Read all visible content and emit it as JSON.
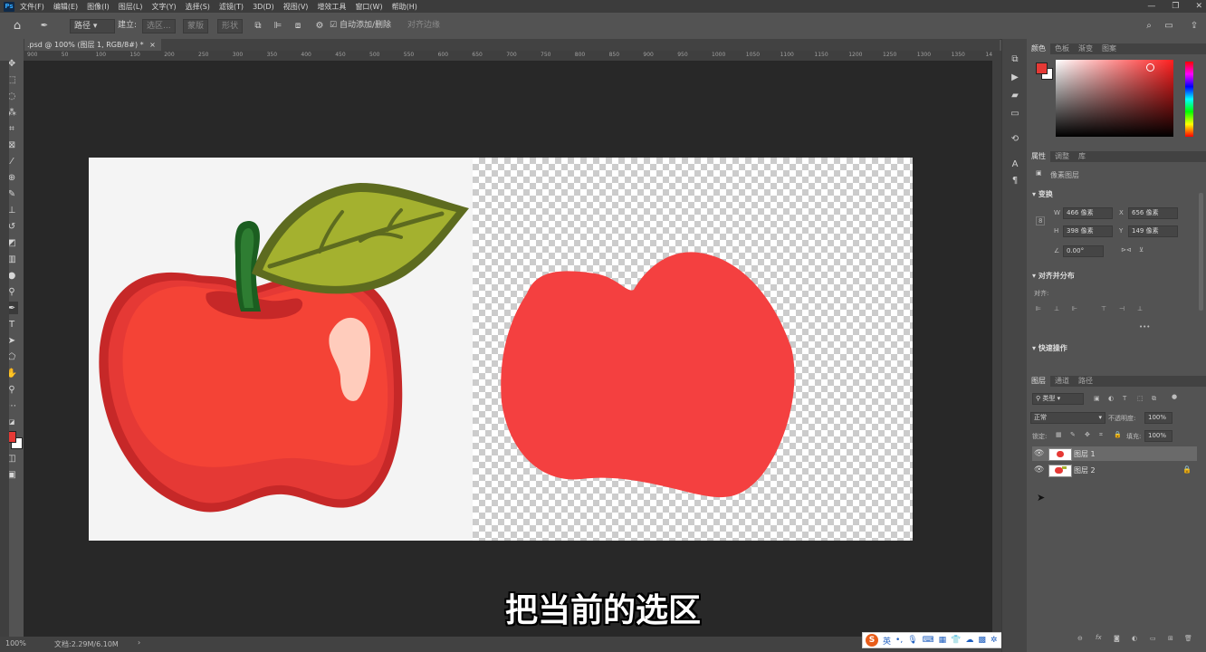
{
  "app": {
    "logo": "Ps"
  },
  "menu": [
    "文件(F)",
    "编辑(E)",
    "图像(I)",
    "图层(L)",
    "文字(Y)",
    "选择(S)",
    "滤镜(T)",
    "3D(D)",
    "视图(V)",
    "增效工具",
    "窗口(W)",
    "帮助(H)"
  ],
  "options": {
    "path_mode": "路径",
    "build": "建立:",
    "selection_btn": "选区...",
    "mask_btn": "蒙版",
    "shape_btn": "形状",
    "auto_add_delete": "自动添加/删除",
    "align_edges": "对齐边缘"
  },
  "document": {
    "tab_title": ".psd @ 100% (图层 1, RGB/8#) *",
    "tab_close": "×"
  },
  "ruler_ticks": [
    "900",
    "50",
    "100",
    "150",
    "200",
    "250",
    "300",
    "350",
    "400",
    "450",
    "500",
    "550",
    "600",
    "650",
    "700",
    "750",
    "800",
    "850",
    "900",
    "950",
    "1000",
    "1050",
    "1100",
    "1150",
    "1200",
    "1250",
    "1300",
    "1350",
    "1400"
  ],
  "subtitle": "把当前的选区",
  "status": {
    "zoom": "100%",
    "doc_info": "文档:2.29M/6.10M",
    "arrow": "›"
  },
  "color_panel": {
    "tabs": [
      "颜色",
      "色板",
      "渐变",
      "图案"
    ],
    "fg_color": "#e53935",
    "bg_color": "#ffffff"
  },
  "properties_panel": {
    "tabs": [
      "属性",
      "调整",
      "库"
    ],
    "kind": "像素图层",
    "transform_title": "变换",
    "w_label": "W",
    "w_value": "466 像素",
    "x_label": "X",
    "x_value": "656 像素",
    "h_label": "H",
    "h_value": "398 像素",
    "y_label": "Y",
    "y_value": "149 像素",
    "angle_value": "0.00°",
    "align_title": "对齐并分布",
    "align_label": "对齐:",
    "more": "•••",
    "quick_title": "快速操作"
  },
  "layers_panel": {
    "tabs": [
      "图层",
      "通道",
      "路径"
    ],
    "filter_kind": "类型",
    "blend_mode": "正常",
    "opacity_label": "不透明度:",
    "opacity_value": "100%",
    "lock_label": "锁定:",
    "fill_label": "填充:",
    "fill_value": "100%",
    "layers": [
      {
        "name": "图层 1",
        "selected": true
      },
      {
        "name": "图层 2",
        "selected": false
      }
    ]
  },
  "ime": {
    "lang": "英",
    "punct": "•,"
  }
}
